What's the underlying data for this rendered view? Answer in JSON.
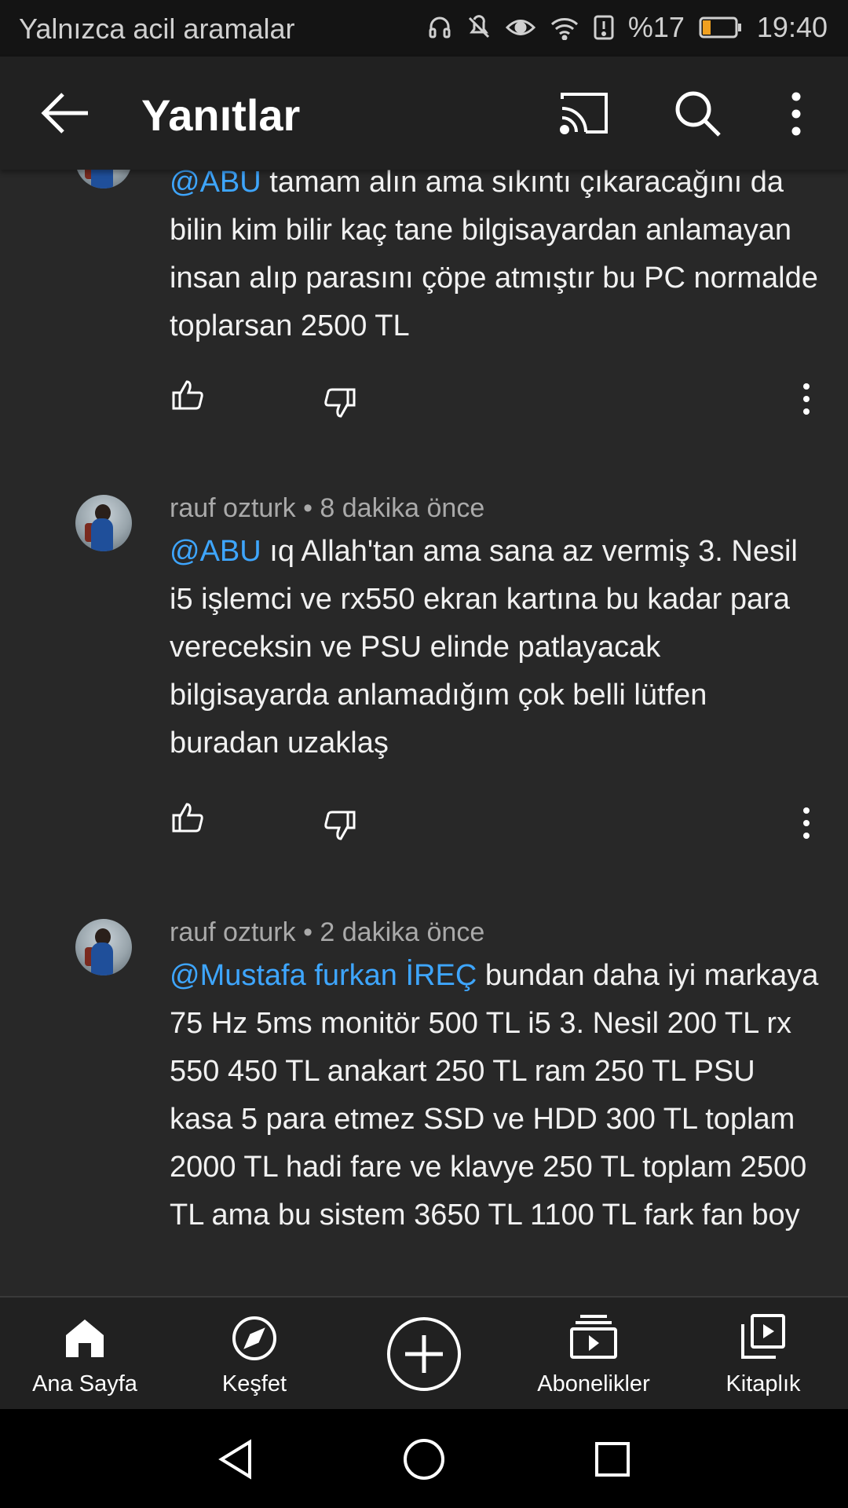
{
  "status_bar": {
    "carrier_text": "Yalnızca acil aramalar",
    "battery_percent": "%17",
    "time": "19:40",
    "icons": [
      "headphones-icon",
      "mute-icon",
      "eye-icon",
      "wifi-icon",
      "alert-icon",
      "battery-icon"
    ]
  },
  "app_bar": {
    "title": "Yanıtlar",
    "icons": [
      "back-arrow-icon",
      "cast-icon",
      "search-icon",
      "more-vert-icon"
    ]
  },
  "comments": [
    {
      "mention": "@ABU",
      "text": " tamam alın ama sıkıntı çıkaracağını da bilin kim bilir kaç tane bilgisayardan anlamayan insan alıp parasını çöpe atmıştır bu PC normalde toplarsan 2500 TL"
    },
    {
      "author": "rauf ozturk",
      "time": "8 dakika önce",
      "mention": "@ABU",
      "text": " ıq Allah'tan ama sana az vermiş 3. Nesil i5 işlemci ve rx550 ekran kartına bu kadar para vereceksin ve PSU elinde patlayacak bilgisayarda anlamadığım çok belli lütfen buradan uzaklaş"
    },
    {
      "author": "rauf ozturk",
      "time": "2 dakika önce",
      "mention": "@Mustafa furkan İREÇ",
      "text": " bundan daha iyi markaya 75 Hz 5ms monitör 500 TL i5 3. Nesil 200 TL rx 550 450 TL anakart 250 TL ram 250 TL PSU kasa 5 para etmez  SSD ve HDD 300 TL toplam 2000 TL hadi fare ve klavye 250 TL toplam 2500 TL ama bu sistem 3650 TL 1100 TL fark fan boy"
    }
  ],
  "bottom_nav": [
    {
      "label": "Ana Sayfa",
      "icon": "home-icon"
    },
    {
      "label": "Keşfet",
      "icon": "compass-icon"
    },
    {
      "label": "",
      "icon": "add-icon"
    },
    {
      "label": "Abonelikler",
      "icon": "subscriptions-icon"
    },
    {
      "label": "Kitaplık",
      "icon": "library-icon"
    }
  ],
  "system_nav": [
    "back-triangle-icon",
    "home-circle-icon",
    "recents-square-icon"
  ],
  "colors": {
    "background": "#282828",
    "app_bar": "#212121",
    "mention": "#3ea6ff",
    "meta_text": "#aaaaaa"
  }
}
